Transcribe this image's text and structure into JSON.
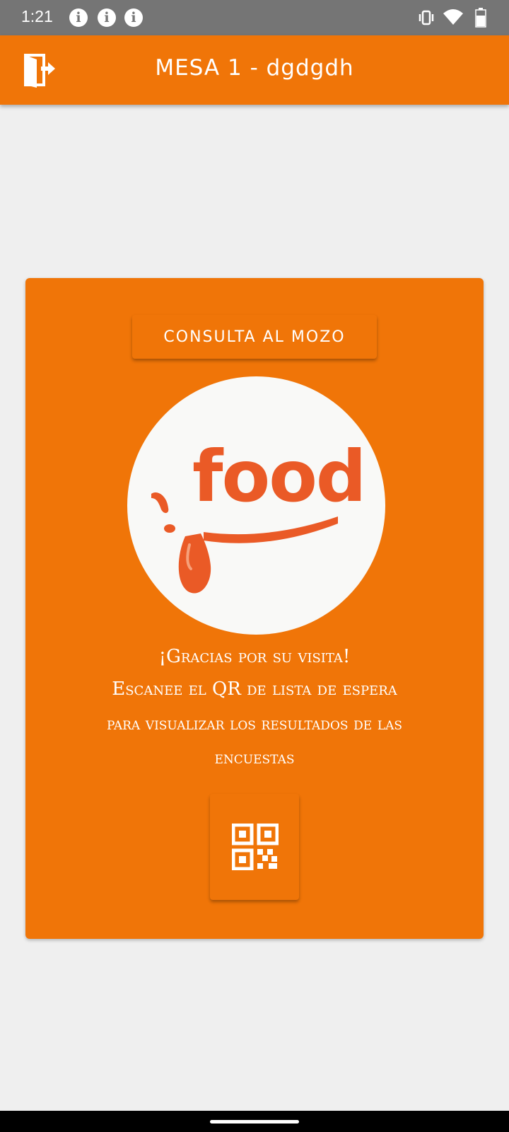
{
  "status_bar": {
    "time": "1:21",
    "notification_icons": [
      "info-icon",
      "info-icon",
      "info-icon"
    ],
    "right_icons": [
      "vibrate-icon",
      "wifi-icon",
      "battery-icon"
    ]
  },
  "app_bar": {
    "title": "MESA 1 - dgdgdh",
    "exit_icon": "exit-door-icon",
    "color": "#f07508"
  },
  "card": {
    "button_label": "CONSULTA AL MOZO",
    "logo_text": "food",
    "message_line1": "¡Gracias por su visita!",
    "message_line2": "Escanee el QR de lista de espera",
    "message_line3": "para visualizar los resultados de las",
    "message_line4": "encuestas",
    "qr_icon": "qr-code-icon",
    "logo_color": "#ea5a26"
  }
}
